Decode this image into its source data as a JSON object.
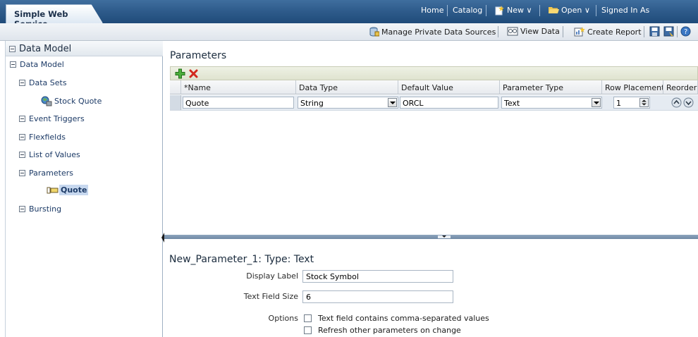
{
  "app": {
    "title": "Simple Web Service"
  },
  "topnav": {
    "home": "Home",
    "catalog": "Catalog",
    "new": "New ∨",
    "open": "Open ∨",
    "signed_in": "Signed In As"
  },
  "toolbar": {
    "manage_private": "Manage Private Data Sources",
    "view_data": "View Data",
    "create_report": "Create Report"
  },
  "left_panel": {
    "header": "Data Model",
    "tree": {
      "root": "Data Model",
      "data_sets": "Data Sets",
      "stock_quote": "Stock Quote",
      "event_triggers": "Event Triggers",
      "flexfields": "Flexfields",
      "list_of_values": "List of Values",
      "parameters": "Parameters",
      "quote": "Quote",
      "bursting": "Bursting"
    }
  },
  "main": {
    "title": "Parameters",
    "columns": {
      "name": "*Name",
      "data_type": "Data Type",
      "default_value": "Default Value",
      "parameter_type": "Parameter Type",
      "row_placement": "Row Placement",
      "reorder": "Reorder"
    },
    "row": {
      "name": "Quote",
      "data_type": "String",
      "default_value": "ORCL",
      "parameter_type": "Text",
      "row_placement": "1"
    }
  },
  "detail": {
    "title": "New_Parameter_1: Type: Text",
    "display_label_label": "Display Label",
    "display_label_value": "Stock Symbol",
    "text_field_size_label": "Text Field Size",
    "text_field_size_value": "6",
    "options_label": "Options",
    "option1": "Text field contains comma-separated values",
    "option2": "Refresh other parameters on change"
  },
  "colors": {
    "topbar": "#2f5c8c",
    "selection": "#c7d8ef",
    "grid_row": "#e5ebf2",
    "splitter": "#7f97b1"
  }
}
